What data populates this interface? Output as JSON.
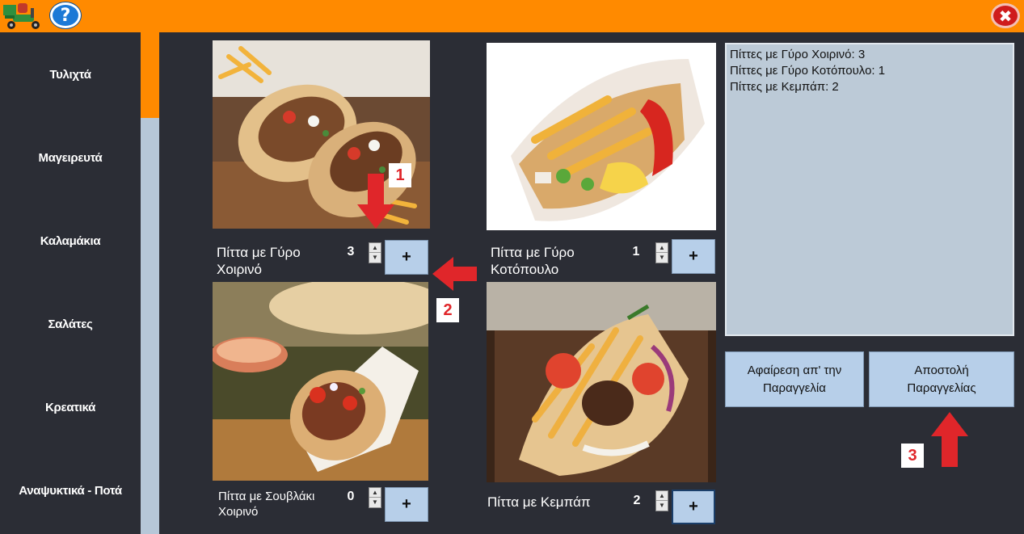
{
  "colors": {
    "topbar": "#ff8a00",
    "sidebar": "#2b2d35",
    "button": "#b7cfe9",
    "order_box": "#bccad7",
    "annotation": "#e0262a"
  },
  "help_label": "?",
  "close_label": "✖",
  "sidebar": {
    "items": [
      {
        "label": "Τυλιχτά"
      },
      {
        "label": "Μαγειρευτά"
      },
      {
        "label": "Καλαμάκια"
      },
      {
        "label": "Σαλάτες"
      },
      {
        "label": "Κρεατικά"
      },
      {
        "label": "Αναψυκτικά - Ποτά"
      }
    ]
  },
  "products": [
    {
      "name_line1": "Πίττα με Γύρο",
      "name_line2": "Χοιρινό",
      "qty": "3",
      "add": "+"
    },
    {
      "name_line1": "Πίττα με Γύρο",
      "name_line2": "Κοτόπουλο",
      "qty": "1",
      "add": "+"
    },
    {
      "name_line1": "Πίττα με Σουβλάκι",
      "name_line2": "Χοιρινό",
      "qty": "0",
      "add": "+"
    },
    {
      "name_line1": "Πίττα με Κεμπάπ",
      "name_line2": "",
      "qty": "2",
      "add": "+"
    }
  ],
  "spinner": {
    "up": "▲",
    "down": "▼"
  },
  "order": {
    "lines": [
      "Πίττες με Γύρο Χοιρινό: 3",
      "Πίττες με Γύρο Κοτόπουλο: 1",
      "Πίττες με Κεμπάπ: 2"
    ],
    "remove_line1": "Αφαίρεση απ' την",
    "remove_line2": "Παραγγελία",
    "send_line1": "Αποστολή",
    "send_line2": "Παραγγελίας"
  },
  "annotations": {
    "one": "1",
    "two": "2",
    "three": "3"
  }
}
